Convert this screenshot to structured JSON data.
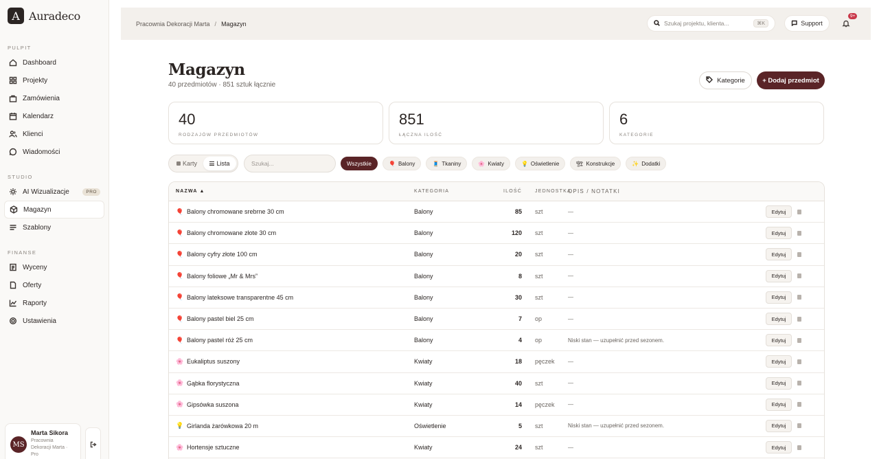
{
  "app": {
    "logo_letter": "A",
    "name": "Auradeco"
  },
  "sidebar": {
    "sections": [
      {
        "label": "PULPIT",
        "items": [
          {
            "label": "Dashboard",
            "icon": "home-icon"
          },
          {
            "label": "Projekty",
            "icon": "grid-icon"
          },
          {
            "label": "Zamówienia",
            "icon": "bag-icon"
          },
          {
            "label": "Kalendarz",
            "icon": "calendar-icon"
          },
          {
            "label": "Klienci",
            "icon": "users-icon"
          },
          {
            "label": "Wiadomości",
            "icon": "chat-icon"
          }
        ]
      },
      {
        "label": "STUDIO",
        "items": [
          {
            "label": "AI Wizualizacje",
            "icon": "sparkle-icon",
            "badge": "PRO"
          },
          {
            "label": "Magazyn",
            "icon": "box-icon",
            "active": true
          },
          {
            "label": "Szablony",
            "icon": "lines-icon"
          }
        ]
      },
      {
        "label": "FINANSE",
        "items": [
          {
            "label": "Wyceny",
            "icon": "document-icon"
          },
          {
            "label": "Oferty",
            "icon": "file-icon"
          },
          {
            "label": "Raporty",
            "icon": "chart-icon"
          },
          {
            "label": "Ustawienia",
            "icon": "gear-icon"
          }
        ]
      }
    ],
    "user": {
      "initials": "MS",
      "name": "Marta Sikora",
      "sub1": "Pracownia",
      "sub2": "Dekoracji Marta ·",
      "sub3": "Pro"
    }
  },
  "topbar": {
    "breadcrumb_root": "Pracownia Dekoracji Marta",
    "breadcrumb_sep": "/",
    "breadcrumb_current": "Magazyn",
    "search_placeholder": "Szukaj projektu, klienta...",
    "search_shortcut": "⌘K",
    "support_label": "Support",
    "notifications_badge": "9+"
  },
  "page": {
    "title": "Magazyn",
    "subtitle": "40 przedmiotów · 851 sztuk łącznie",
    "categories_button": "Kategorie",
    "add_button": "+ Dodaj przedmiot"
  },
  "stats": [
    {
      "value": "40",
      "label": "RODZAJÓW PRZEDMIOTÓW"
    },
    {
      "value": "851",
      "label": "ŁĄCZNA ILOŚĆ"
    },
    {
      "value": "6",
      "label": "KATEGORIE"
    }
  ],
  "toolbar": {
    "view_cards": "Karty",
    "view_list": "Lista",
    "search_placeholder": "Szukaj...",
    "filters": [
      {
        "label": "Wszystkie",
        "emoji": "",
        "active": true
      },
      {
        "label": "Balony",
        "emoji": "🎈"
      },
      {
        "label": "Tkaniny",
        "emoji": "🧵"
      },
      {
        "label": "Kwiaty",
        "emoji": "🌸"
      },
      {
        "label": "Oświetlenie",
        "emoji": "💡"
      },
      {
        "label": "Konstrukcje",
        "emoji": "🏗"
      },
      {
        "label": "Dodatki",
        "emoji": "✨"
      }
    ]
  },
  "table": {
    "headers": {
      "name": "NAZWA ▲",
      "category": "KATEGORIA",
      "qty": "ILOŚĆ",
      "unit": "JEDNOSTKA",
      "notes": "OPIS / NOTATKI"
    },
    "edit_label": "Edytuj",
    "rows": [
      {
        "emoji": "🎈",
        "name": "Balony chromowane srebrne 30 cm",
        "category": "Balony",
        "qty": "85",
        "unit": "szt",
        "notes": "—"
      },
      {
        "emoji": "🎈",
        "name": "Balony chromowane złote 30 cm",
        "category": "Balony",
        "qty": "120",
        "unit": "szt",
        "notes": "—"
      },
      {
        "emoji": "🎈",
        "name": "Balony cyfry złote 100 cm",
        "category": "Balony",
        "qty": "20",
        "unit": "szt",
        "notes": "—"
      },
      {
        "emoji": "🎈",
        "name": "Balony foliowe „Mr & Mrs”",
        "category": "Balony",
        "qty": "8",
        "unit": "szt",
        "notes": "—"
      },
      {
        "emoji": "🎈",
        "name": "Balony lateksowe transparentne 45 cm",
        "category": "Balony",
        "qty": "30",
        "unit": "szt",
        "notes": "—"
      },
      {
        "emoji": "🎈",
        "name": "Balony pastel biel 25 cm",
        "category": "Balony",
        "qty": "7",
        "unit": "op",
        "notes": "—"
      },
      {
        "emoji": "🎈",
        "name": "Balony pastel róż 25 cm",
        "category": "Balony",
        "qty": "4",
        "unit": "op",
        "notes": "Niski stan — uzupełnić przed sezonem."
      },
      {
        "emoji": "🌸",
        "name": "Eukaliptus suszony",
        "category": "Kwiaty",
        "qty": "18",
        "unit": "pęczek",
        "notes": "—"
      },
      {
        "emoji": "🌸",
        "name": "Gąbka florystyczna",
        "category": "Kwiaty",
        "qty": "40",
        "unit": "szt",
        "notes": "—"
      },
      {
        "emoji": "🌸",
        "name": "Gipsówka suszona",
        "category": "Kwiaty",
        "qty": "14",
        "unit": "pęczek",
        "notes": "—"
      },
      {
        "emoji": "💡",
        "name": "Girlanda żarówkowa 20 m",
        "category": "Oświetlenie",
        "qty": "5",
        "unit": "szt",
        "notes": "Niski stan — uzupełnić przed sezonem."
      },
      {
        "emoji": "🌸",
        "name": "Hortensje sztuczne",
        "category": "Kwiaty",
        "qty": "24",
        "unit": "szt",
        "notes": "—"
      }
    ]
  }
}
